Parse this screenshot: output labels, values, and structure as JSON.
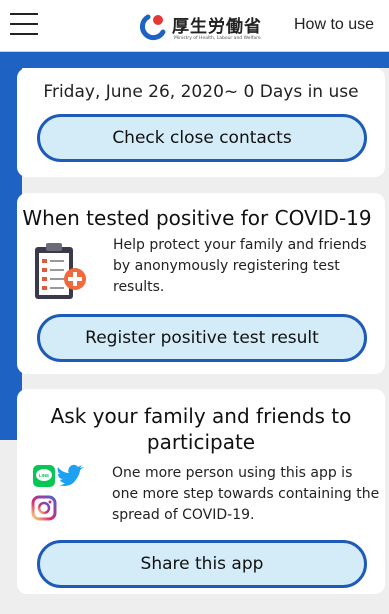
{
  "header": {
    "logo_jp": "厚生労働省",
    "logo_en": "Ministry of Health, Labour and Welfare",
    "how_to": "How to use"
  },
  "status_card": {
    "date_text": "Friday, June 26, 2020~ 0 Days in use",
    "button_label": "Check close contacts"
  },
  "positive_card": {
    "title": "When tested positive for COVID-19",
    "body": "Help protect your family and friends by anonymously registering test results.",
    "button_label": "Register positive test result",
    "icon": "clipboard-medical-icon"
  },
  "share_card": {
    "title": "Ask your family and friends to participate",
    "body": "One more person using this app is one more step towards containing the spread of COVID-19.",
    "button_label": "Share this app",
    "icons": [
      "line-icon",
      "twitter-icon",
      "instagram-icon"
    ],
    "line_icon_text": "LINE"
  },
  "colors": {
    "accent_blue": "#1e63c4",
    "button_fill": "#d4ecf8",
    "button_border": "#1e5ab8",
    "background": "#eeeeee"
  }
}
